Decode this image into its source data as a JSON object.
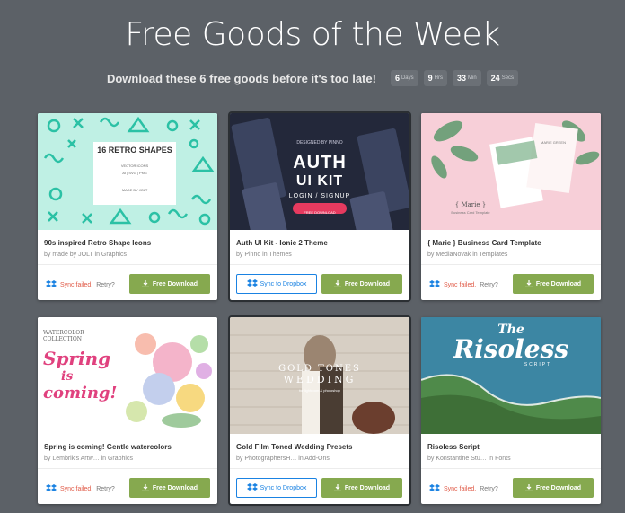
{
  "header": {
    "title": "Free Goods of the Week",
    "subtitle": "Download these 6 free goods before it's too late!",
    "countdown": [
      {
        "value": "6",
        "unit": "Days"
      },
      {
        "value": "9",
        "unit": "Hrs"
      },
      {
        "value": "33",
        "unit": "Min"
      },
      {
        "value": "24",
        "unit": "Secs"
      }
    ]
  },
  "labels": {
    "sync_failed": "Sync failed.",
    "retry": "Retry?",
    "sync_to_dropbox": "Sync to Dropbox",
    "free_download": "Free Download"
  },
  "cards": [
    {
      "name": "90s inspired Retro Shape Icons",
      "byline": "by made by JOLT in Graphics",
      "thumb": {
        "bg": "#bff0e4",
        "text1": "16  RETRO SHAPES",
        "text2": "VECTOR  ICONS",
        "text3": "AI   |   SVG   |   PNG",
        "text4": "MADE BY JOLT"
      }
    },
    {
      "name": "Auth UI Kit - Ionic 2 Theme",
      "byline": "by Pinno in Themes",
      "thumb": {
        "bg": "#23283a",
        "text1": "AUTH",
        "text2": "UI KIT",
        "text3": "LOGIN / SIGNUP",
        "text4": "DESIGNED BY PINNO",
        "text5": "FREE DOWNLOAD"
      }
    },
    {
      "name": "{ Marie } Business Card Template",
      "byline": "by MediaNovak in Templates",
      "thumb": {
        "bg": "#f7cfd8",
        "text1": "{ Marie }",
        "text2": "Business Card Template",
        "text3": "MARIE GREEN"
      }
    },
    {
      "name": "Spring is coming! Gentle watercolors",
      "byline": "by Lembrik's Artw… in Graphics",
      "thumb": {
        "bg": "#ffffff",
        "text1": "WATERCOLOR",
        "text2": "COLLECTION",
        "text3": "Spring",
        "text4": "is",
        "text5": "coming!"
      }
    },
    {
      "name": "Gold Film Toned Wedding Presets",
      "byline": "by PhotographersH… in Add-Ons",
      "thumb": {
        "bg": "#c9c1b6",
        "text1": "GOLD TONES",
        "text2": "WEDDING",
        "text3": "for lightroom & photoshop"
      }
    },
    {
      "name": "Risoless Script",
      "byline": "by Konstantine Stu… in Fonts",
      "thumb": {
        "bg": "#3f7f98",
        "text1": "The",
        "text2": "Risoless",
        "text3": "SCRIPT"
      }
    }
  ],
  "card_states": [
    "sync-failed",
    "sync-button",
    "sync-failed",
    "sync-failed",
    "sync-button",
    "sync-failed"
  ]
}
